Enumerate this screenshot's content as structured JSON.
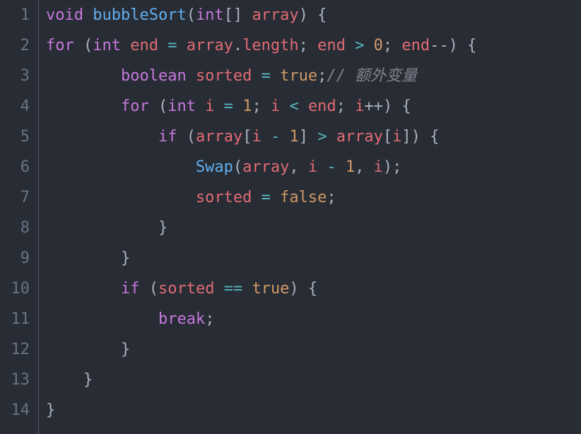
{
  "editor": {
    "lines": [
      {
        "num": "1",
        "indent": 0,
        "tokens": [
          {
            "t": "void ",
            "c": "kw"
          },
          {
            "t": "bubbleSort",
            "c": "fn"
          },
          {
            "t": "(",
            "c": "pun"
          },
          {
            "t": "int",
            "c": "ty"
          },
          {
            "t": "[] ",
            "c": "pun"
          },
          {
            "t": "array",
            "c": "id"
          },
          {
            "t": ") {",
            "c": "pun"
          }
        ]
      },
      {
        "num": "2",
        "indent": 0,
        "tokens": [
          {
            "t": "for ",
            "c": "kw"
          },
          {
            "t": "(",
            "c": "pun"
          },
          {
            "t": "int ",
            "c": "ty"
          },
          {
            "t": "end ",
            "c": "id"
          },
          {
            "t": "= ",
            "c": "op"
          },
          {
            "t": "array",
            "c": "id"
          },
          {
            "t": ".",
            "c": "pun"
          },
          {
            "t": "length",
            "c": "prop"
          },
          {
            "t": "; ",
            "c": "pun"
          },
          {
            "t": "end ",
            "c": "id"
          },
          {
            "t": "> ",
            "c": "op"
          },
          {
            "t": "0",
            "c": "num"
          },
          {
            "t": "; ",
            "c": "pun"
          },
          {
            "t": "end",
            "c": "id"
          },
          {
            "t": "--",
            "c": "op2"
          },
          {
            "t": ") {",
            "c": "pun"
          }
        ]
      },
      {
        "num": "3",
        "indent": 2,
        "tokens": [
          {
            "t": "boolean ",
            "c": "ty"
          },
          {
            "t": "sorted ",
            "c": "id"
          },
          {
            "t": "= ",
            "c": "op"
          },
          {
            "t": "true",
            "c": "bool"
          },
          {
            "t": ";",
            "c": "pun"
          },
          {
            "t": "// 额外变量",
            "c": "cmt"
          }
        ]
      },
      {
        "num": "4",
        "indent": 2,
        "tokens": [
          {
            "t": "for ",
            "c": "kw"
          },
          {
            "t": "(",
            "c": "pun"
          },
          {
            "t": "int ",
            "c": "ty"
          },
          {
            "t": "i ",
            "c": "id"
          },
          {
            "t": "= ",
            "c": "op"
          },
          {
            "t": "1",
            "c": "num"
          },
          {
            "t": "; ",
            "c": "pun"
          },
          {
            "t": "i ",
            "c": "id"
          },
          {
            "t": "< ",
            "c": "op"
          },
          {
            "t": "end",
            "c": "id"
          },
          {
            "t": "; ",
            "c": "pun"
          },
          {
            "t": "i",
            "c": "id"
          },
          {
            "t": "++",
            "c": "op2"
          },
          {
            "t": ") {",
            "c": "pun"
          }
        ]
      },
      {
        "num": "5",
        "indent": 3,
        "tokens": [
          {
            "t": "if ",
            "c": "kw"
          },
          {
            "t": "(",
            "c": "pun"
          },
          {
            "t": "array",
            "c": "id"
          },
          {
            "t": "[",
            "c": "pun"
          },
          {
            "t": "i ",
            "c": "id"
          },
          {
            "t": "- ",
            "c": "op"
          },
          {
            "t": "1",
            "c": "num"
          },
          {
            "t": "] ",
            "c": "pun"
          },
          {
            "t": "> ",
            "c": "op"
          },
          {
            "t": "array",
            "c": "id"
          },
          {
            "t": "[",
            "c": "pun"
          },
          {
            "t": "i",
            "c": "id"
          },
          {
            "t": "]) {",
            "c": "pun"
          }
        ]
      },
      {
        "num": "6",
        "indent": 4,
        "tokens": [
          {
            "t": "Swap",
            "c": "fn"
          },
          {
            "t": "(",
            "c": "pun"
          },
          {
            "t": "array",
            "c": "id"
          },
          {
            "t": ", ",
            "c": "pun"
          },
          {
            "t": "i ",
            "c": "id"
          },
          {
            "t": "- ",
            "c": "op"
          },
          {
            "t": "1",
            "c": "num"
          },
          {
            "t": ", ",
            "c": "pun"
          },
          {
            "t": "i",
            "c": "id"
          },
          {
            "t": ");",
            "c": "pun"
          }
        ]
      },
      {
        "num": "7",
        "indent": 4,
        "tokens": [
          {
            "t": "sorted ",
            "c": "id"
          },
          {
            "t": "= ",
            "c": "op"
          },
          {
            "t": "false",
            "c": "bool"
          },
          {
            "t": ";",
            "c": "pun"
          }
        ]
      },
      {
        "num": "8",
        "indent": 3,
        "tokens": [
          {
            "t": "}",
            "c": "pun"
          }
        ]
      },
      {
        "num": "9",
        "indent": 2,
        "tokens": [
          {
            "t": "}",
            "c": "pun"
          }
        ]
      },
      {
        "num": "10",
        "indent": 2,
        "tokens": [
          {
            "t": "if ",
            "c": "kw"
          },
          {
            "t": "(",
            "c": "pun"
          },
          {
            "t": "sorted ",
            "c": "id"
          },
          {
            "t": "== ",
            "c": "op"
          },
          {
            "t": "true",
            "c": "bool"
          },
          {
            "t": ") {",
            "c": "pun"
          }
        ]
      },
      {
        "num": "11",
        "indent": 3,
        "tokens": [
          {
            "t": "break",
            "c": "kw"
          },
          {
            "t": ";",
            "c": "pun"
          }
        ]
      },
      {
        "num": "12",
        "indent": 2,
        "tokens": [
          {
            "t": "}",
            "c": "pun"
          }
        ]
      },
      {
        "num": "13",
        "indent": 1,
        "tokens": [
          {
            "t": "}",
            "c": "pun"
          }
        ]
      },
      {
        "num": "14",
        "indent": 0,
        "tokens": [
          {
            "t": "}",
            "c": "pun"
          }
        ]
      }
    ],
    "indent_unit": "    "
  }
}
